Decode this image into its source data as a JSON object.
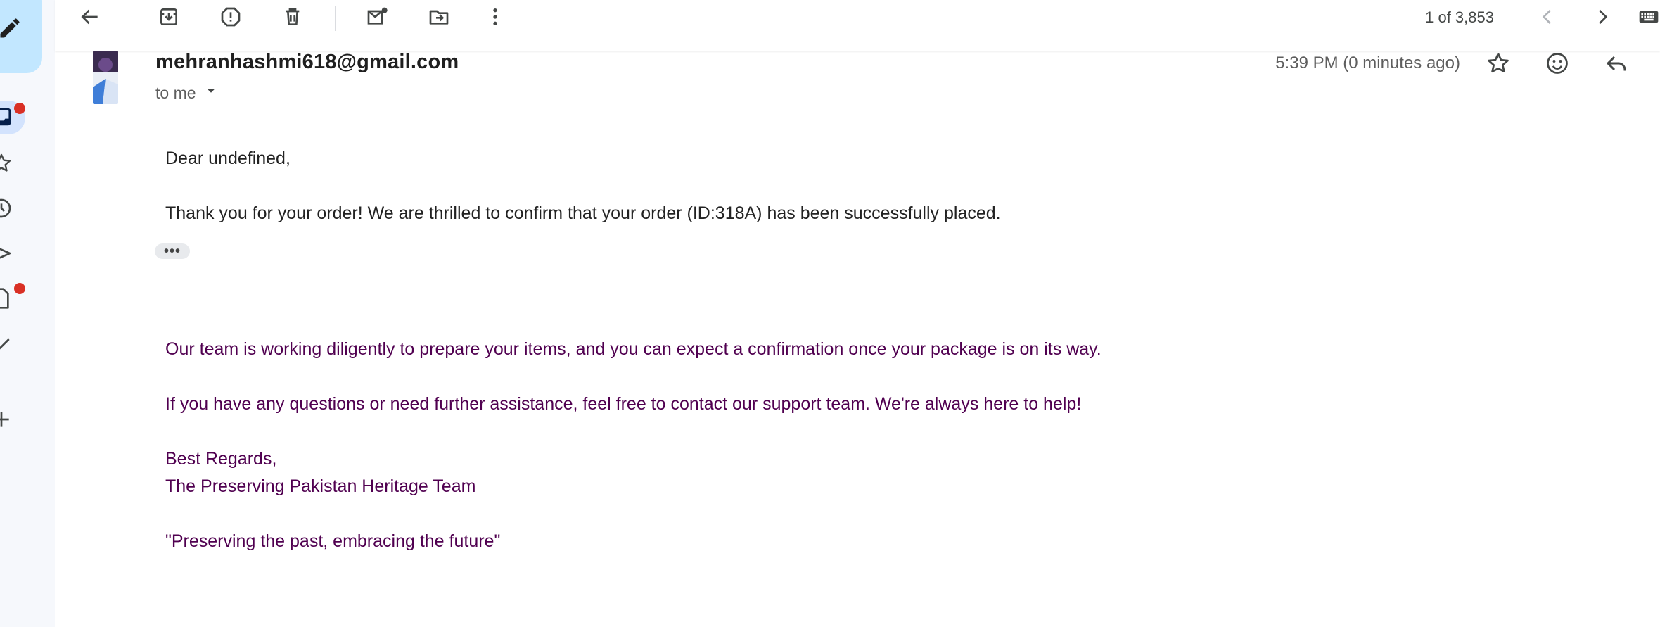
{
  "toolbar": {
    "back_icon": "arrow-left-icon",
    "archive_icon": "archive-icon",
    "spam_icon": "report-spam-icon",
    "delete_icon": "trash-icon",
    "mark_unread_icon": "mark-unread-icon",
    "move_icon": "move-to-icon",
    "more_icon": "more-vert-icon",
    "count": "1 of 3,853",
    "prev_icon": "chevron-left-icon",
    "next_icon": "chevron-right-icon",
    "keyboard_icon": "keyboard-icon"
  },
  "sidebar": {
    "compose_icon": "pencil-icon",
    "items": [
      {
        "name": "inbox",
        "icon": "inbox-icon",
        "badge": true
      },
      {
        "name": "starred",
        "icon": "star-icon",
        "badge": false
      },
      {
        "name": "snoozed",
        "icon": "clock-icon",
        "badge": false
      },
      {
        "name": "sent",
        "icon": "send-icon",
        "badge": false
      },
      {
        "name": "drafts",
        "icon": "draft-icon",
        "badge": true
      },
      {
        "name": "done",
        "icon": "check-icon",
        "badge": false
      },
      {
        "name": "add",
        "icon": "plus-icon",
        "badge": false
      }
    ]
  },
  "email": {
    "sender": "mehranhashmi618@gmail.com",
    "recipient": "to me",
    "timestamp": "5:39 PM (0 minutes ago)",
    "greeting": "Dear undefined,",
    "line1": "Thank you for your order! We are thrilled to confirm that your order (ID:318A) has been successfully placed.",
    "ellipsis": "•••",
    "line2": "Our team is working diligently to prepare your items, and you can expect a confirmation once your package is on its way.",
    "line3": "If you have any questions or need further assistance, feel free to contact our support team. We're always here to help!",
    "signoff": "Best Regards,",
    "team": "The Preserving Pakistan Heritage Team",
    "tagline": "\"Preserving the past, embracing the future\""
  },
  "colors": {
    "accent_compose": "#c2e7ff",
    "rail_bg": "#f6f8fc",
    "badge": "#d93025",
    "quoted_text": "#500050"
  }
}
